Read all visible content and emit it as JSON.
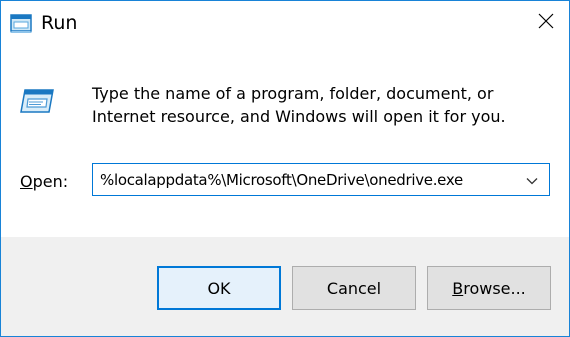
{
  "window": {
    "title": "Run",
    "accent_color": "#0078d7"
  },
  "body": {
    "description": "Type the name of a program, folder, document, or Internet resource, and Windows will open it for you.",
    "open_label_accel": "O",
    "open_label_rest": "pen:",
    "open_value": "%localappdata%\\Microsoft\\OneDrive\\onedrive.exe"
  },
  "buttons": {
    "ok_label": "OK",
    "cancel_label": "Cancel",
    "browse_accel": "B",
    "browse_rest": "rowse..."
  },
  "icons": {
    "app": "run-app-icon",
    "close": "close-icon",
    "dropdown": "chevron-down-icon",
    "illustration": "run-illustration-icon"
  }
}
